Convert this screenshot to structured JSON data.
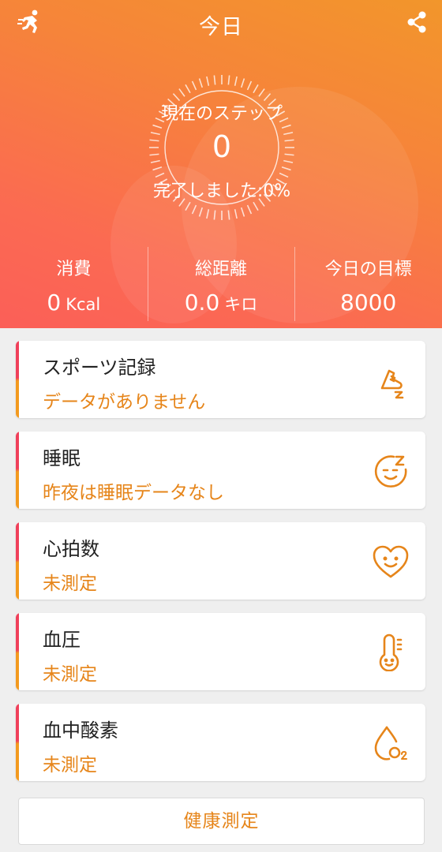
{
  "header": {
    "title": "今日",
    "left_icon": "runner-icon",
    "right_icon": "share-icon"
  },
  "dial": {
    "label": "現在のステップ",
    "steps": "0",
    "completion": "完了しました:0%",
    "progress_percent": 0
  },
  "stats": [
    {
      "label": "消費",
      "value": "0",
      "unit": "Kcal"
    },
    {
      "label": "総距離",
      "value": "0.0",
      "unit": "キロ"
    },
    {
      "label": "今日の目標",
      "value": "8000",
      "unit": ""
    }
  ],
  "cards": [
    {
      "title": "スポーツ記録",
      "status": "データがありません",
      "icon": "shoe-icon"
    },
    {
      "title": "睡眠",
      "status": "昨夜は睡眠データなし",
      "icon": "sleep-face-icon"
    },
    {
      "title": "心拍数",
      "status": "未測定",
      "icon": "heart-face-icon"
    },
    {
      "title": "血圧",
      "status": "未測定",
      "icon": "thermometer-face-icon"
    },
    {
      "title": "血中酸素",
      "status": "未測定",
      "icon": "oxygen-drop-icon"
    }
  ],
  "footer": {
    "button_label": "健康測定"
  },
  "colors": {
    "header_gradient_start": "#f2962b",
    "header_gradient_end": "#fb5f58",
    "accent_orange": "#e6851a",
    "card_bar_red": "#f0405a",
    "card_bar_orange": "#f39a1f"
  }
}
